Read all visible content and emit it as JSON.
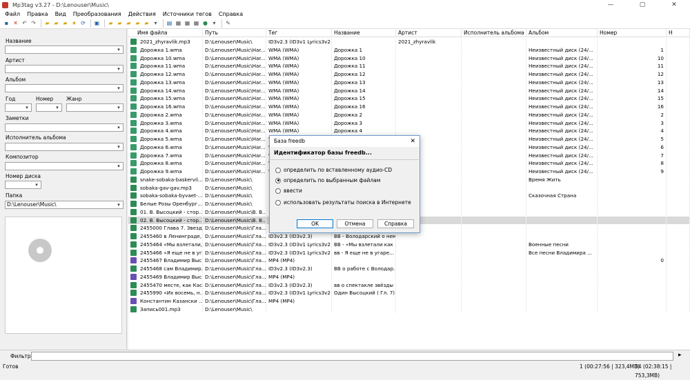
{
  "window": {
    "title": "Mp3tag v3.27  -  D:\\Lenouser\\Music\\",
    "min": "—",
    "max": "▢",
    "close": "✕"
  },
  "menu": [
    "Файл",
    "Правка",
    "Вид",
    "Преобразования",
    "Действия",
    "Источники тегов",
    "Справка"
  ],
  "left_panel": {
    "fields": [
      {
        "label": "Название",
        "value": ""
      },
      {
        "label": "Артист",
        "value": ""
      },
      {
        "label": "Альбом",
        "value": ""
      },
      {
        "label": "Заметки",
        "value": ""
      },
      {
        "label": "Исполнитель альбома",
        "value": ""
      },
      {
        "label": "Композитор",
        "value": ""
      }
    ],
    "year_label": "Год",
    "track_label": "Номер",
    "genre_label": "Жанр",
    "disc_label": "Номер диска",
    "folder_label": "Папка",
    "folder_value": "D:\\Lenouser\\Music\\"
  },
  "grid": {
    "columns": [
      "Имя файла",
      "Путь",
      "Тег",
      "Название",
      "Артист",
      "Исполнитель альбома",
      "Альбом",
      "Номер",
      "Н"
    ],
    "rows": [
      [
        "2021_zhyravlik.mp3",
        "D:\\Lenouser\\Music\\",
        "ID3v2.3 (ID3v1 Lyrics3v2 ...",
        "",
        "2021_zhyravlik",
        "",
        "",
        "",
        ""
      ],
      [
        "Дорожка 1.wma",
        "D:\\Lenouser\\Music\\Har...",
        "WMA (WMA)",
        "Дорожка 1",
        "",
        "",
        "Неизвестный диск (24/...",
        "1",
        ""
      ],
      [
        "Дорожка 10.wma",
        "D:\\Lenouser\\Music\\Har...",
        "WMA (WMA)",
        "Дорожка 10",
        "",
        "",
        "Неизвестный диск (24/...",
        "10",
        ""
      ],
      [
        "Дорожка 11.wma",
        "D:\\Lenouser\\Music\\Har...",
        "WMA (WMA)",
        "Дорожка 11",
        "",
        "",
        "Неизвестный диск (24/...",
        "11",
        ""
      ],
      [
        "Дорожка 12.wma",
        "D:\\Lenouser\\Music\\Har...",
        "WMA (WMA)",
        "Дорожка 12",
        "",
        "",
        "Неизвестный диск (24/...",
        "12",
        ""
      ],
      [
        "Дорожка 13.wma",
        "D:\\Lenouser\\Music\\Har...",
        "WMA (WMA)",
        "Дорожка 13",
        "",
        "",
        "Неизвестный диск (24/...",
        "13",
        ""
      ],
      [
        "Дорожка 14.wma",
        "D:\\Lenouser\\Music\\Har...",
        "WMA (WMA)",
        "Дорожка 14",
        "",
        "",
        "Неизвестный диск (24/...",
        "14",
        ""
      ],
      [
        "Дорожка 15.wma",
        "D:\\Lenouser\\Music\\Har...",
        "WMA (WMA)",
        "Дорожка 15",
        "",
        "",
        "Неизвестный диск (24/...",
        "15",
        ""
      ],
      [
        "Дорожка 16.wma",
        "D:\\Lenouser\\Music\\Har...",
        "WMA (WMA)",
        "Дорожка 16",
        "",
        "",
        "Неизвестный диск (24/...",
        "16",
        ""
      ],
      [
        "Дорожка 2.wma",
        "D:\\Lenouser\\Music\\Har...",
        "WMA (WMA)",
        "Дорожка 2",
        "",
        "",
        "Неизвестный диск (24/...",
        "2",
        ""
      ],
      [
        "Дорожка 3.wma",
        "D:\\Lenouser\\Music\\Har...",
        "WMA (WMA)",
        "Дорожка 3",
        "",
        "",
        "Неизвестный диск (24/...",
        "3",
        ""
      ],
      [
        "Дорожка 4.wma",
        "D:\\Lenouser\\Music\\Har...",
        "WMA (WMA)",
        "Дорожка 4",
        "",
        "",
        "Неизвестный диск (24/...",
        "4",
        ""
      ],
      [
        "Дорожка 5.wma",
        "D:\\Lenouser\\Music\\Har...",
        "WMA (WMA)",
        "",
        "",
        "",
        "Неизвестный диск (24/...",
        "5",
        ""
      ],
      [
        "Дорожка 6.wma",
        "D:\\Lenouser\\Music\\Har...",
        "WMA (WMA)",
        "",
        "",
        "",
        "Неизвестный диск (24/...",
        "6",
        ""
      ],
      [
        "Дорожка 7.wma",
        "D:\\Lenouser\\Music\\Har...",
        "WMA (WMA)",
        "",
        "",
        "",
        "Неизвестный диск (24/...",
        "7",
        ""
      ],
      [
        "Дорожка 8.wma",
        "D:\\Lenouser\\Music\\Har...",
        "WMA (WMA)",
        "",
        "",
        "",
        "Неизвестный диск (24/...",
        "8",
        ""
      ],
      [
        "Дорожка 9.wma",
        "D:\\Lenouser\\Music\\Har...",
        "WMA (WMA)",
        "",
        "",
        "",
        "Неизвестный диск (24/...",
        "9",
        ""
      ],
      [
        "snake-sobaka-baskervil...",
        "D:\\Lenouser\\Music\\",
        "",
        "",
        "",
        "",
        "Время Жить",
        "",
        ""
      ],
      [
        "sobaka-gav-gav.mp3",
        "D:\\Lenouser\\Music\\",
        "",
        "",
        "",
        "",
        "",
        "",
        ""
      ],
      [
        "sobaka-sobaka-byvaet-...",
        "D:\\Lenouser\\Music\\",
        "",
        "",
        "",
        "",
        "Сказочная Страна",
        "",
        ""
      ],
      [
        "Белые Розы Оренбург...",
        "D:\\Lenouser\\Music\\",
        "",
        "",
        "",
        "",
        "",
        "",
        ""
      ],
      [
        "01. В. Высоцкий - стор...",
        "D:\\Lenouser\\Music\\В. В...",
        "",
        "",
        "",
        "",
        "",
        "",
        ""
      ],
      [
        "02. В. Высоцкий - стор...",
        "D:\\Lenouser\\Music\\В. В...",
        "",
        "",
        "",
        "",
        "",
        "",
        ""
      ],
      [
        "2455000 Глава 7. Звезд...",
        "D:\\Lenouser\\Music\\Гла...",
        "",
        "",
        "",
        "",
        "",
        "",
        ""
      ],
      [
        "2455460 в Ленинграде, ...",
        "D:\\Lenouser\\Music\\Гла...",
        "ID3v2.3 (ID3v2.3)",
        "ВВ - Володарский о нем",
        "",
        "",
        "",
        "",
        ""
      ],
      [
        "2455464 «Мы взлетали,...",
        "D:\\Lenouser\\Music\\Гла...",
        "ID3v2.3 (ID3v1 Lyrics3v2 ...",
        "ВВ - «Мы взлетали как ...",
        "",
        "",
        "Военные песни",
        "",
        ""
      ],
      [
        "2455466 «Я еще не в уг...",
        "D:\\Lenouser\\Music\\Гла...",
        "ID3v2.3 (ID3v1 Lyrics3v2 ...",
        "вв - Я еще не в угаре...",
        "",
        "",
        "Все песни Владимира ...",
        "",
        ""
      ],
      [
        "2455467 Владимир Выс...",
        "D:\\Lenouser\\Music\\Гла...",
        "MP4 (MP4)",
        "",
        "",
        "",
        "",
        "0",
        ""
      ],
      [
        "2455468 сам Владимир...",
        "D:\\Lenouser\\Music\\Гла...",
        "ID3v2.3 (ID3v2.3)",
        "ВВ о работе с Володар...",
        "",
        "",
        "",
        "",
        ""
      ],
      [
        "2455469 Владимир Выс...",
        "D:\\Lenouser\\Music\\Гла...",
        "MP4 (MP4)",
        "",
        "",
        "",
        "",
        "",
        ""
      ],
      [
        "2455470 месте, как Кас...",
        "D:\\Lenouser\\Music\\Гла...",
        "ID3v2.3 (ID3v2.3)",
        "вв о спектакле звёзды ...",
        "",
        "",
        "",
        "",
        ""
      ],
      [
        "2455990 «Их восемь, н...",
        "D:\\Lenouser\\Music\\Гла...",
        "ID3v2.3 (ID3v1 Lyrics3v2 ...",
        "Один Высоцкий ( Гл. 7)...",
        "",
        "",
        "",
        "",
        ""
      ],
      [
        "Константин Казански ...",
        "D:\\Lenouser\\Music\\Гла...",
        "MP4 (MP4)",
        "",
        "",
        "",
        "",
        "",
        ""
      ],
      [
        "Запись001.mp3",
        "D:\\Lenouser\\Music\\",
        "",
        "",
        "",
        "",
        "",
        "",
        ""
      ]
    ]
  },
  "filter": {
    "label": "Фильтр:",
    "value": ""
  },
  "status": {
    "left": "Готов",
    "sel": "1 (00:27:56 | 323,4MB)",
    "total": "34 (02:38:15 | 753,3MB)"
  },
  "dialog": {
    "title": "База freedb",
    "close": "✕",
    "heading": "Идентификатор базы freedb...",
    "options": [
      {
        "label": "определить по вставленному аудио-CD",
        "selected": false
      },
      {
        "label": "определить по выбранным файлам",
        "selected": true
      },
      {
        "label": "ввести",
        "selected": false
      },
      {
        "label": "использовать результаты поиска в Интернете",
        "selected": false
      }
    ],
    "ok": "OK",
    "cancel": "Отмена",
    "help": "Справка"
  },
  "icons": [
    "save-icon",
    "delete-icon",
    "undo-icon",
    "redo-icon",
    "folder-icon",
    "star-icon",
    "refresh-icon",
    "tag-icon",
    "wrench-icon",
    "globe-icon"
  ],
  "colors": {
    "mp3_icon": "#2e8b57",
    "wma_icon": "#3a9a6a",
    "mp4_icon": "#6a4fb3",
    "selected_row": "#d9d9d9",
    "dialog_border": "#6b9bd1"
  }
}
